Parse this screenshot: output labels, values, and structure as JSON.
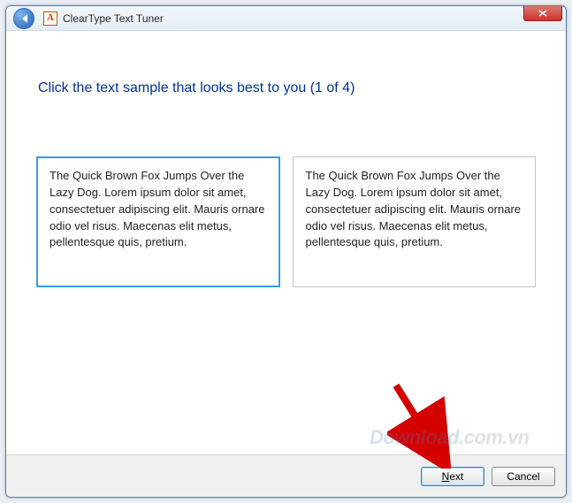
{
  "window": {
    "title": "ClearType Text Tuner"
  },
  "heading": "Click the text sample that looks best to you (1 of 4)",
  "samples": [
    {
      "text": "The Quick Brown Fox Jumps Over the Lazy Dog. Lorem ipsum dolor sit amet, consectetuer adipiscing elit. Mauris ornare odio vel risus. Maecenas elit metus, pellentesque quis, pretium.",
      "selected": true
    },
    {
      "text": "The Quick Brown Fox Jumps Over the Lazy Dog. Lorem ipsum dolor sit amet, consectetuer adipiscing elit. Mauris ornare odio vel risus. Maecenas elit metus, pellentesque quis, pretium.",
      "selected": false
    }
  ],
  "footer": {
    "next_label": "Next",
    "cancel_label": "Cancel"
  },
  "watermark": {
    "brand": "Download",
    "suffix": ".com.vn"
  }
}
